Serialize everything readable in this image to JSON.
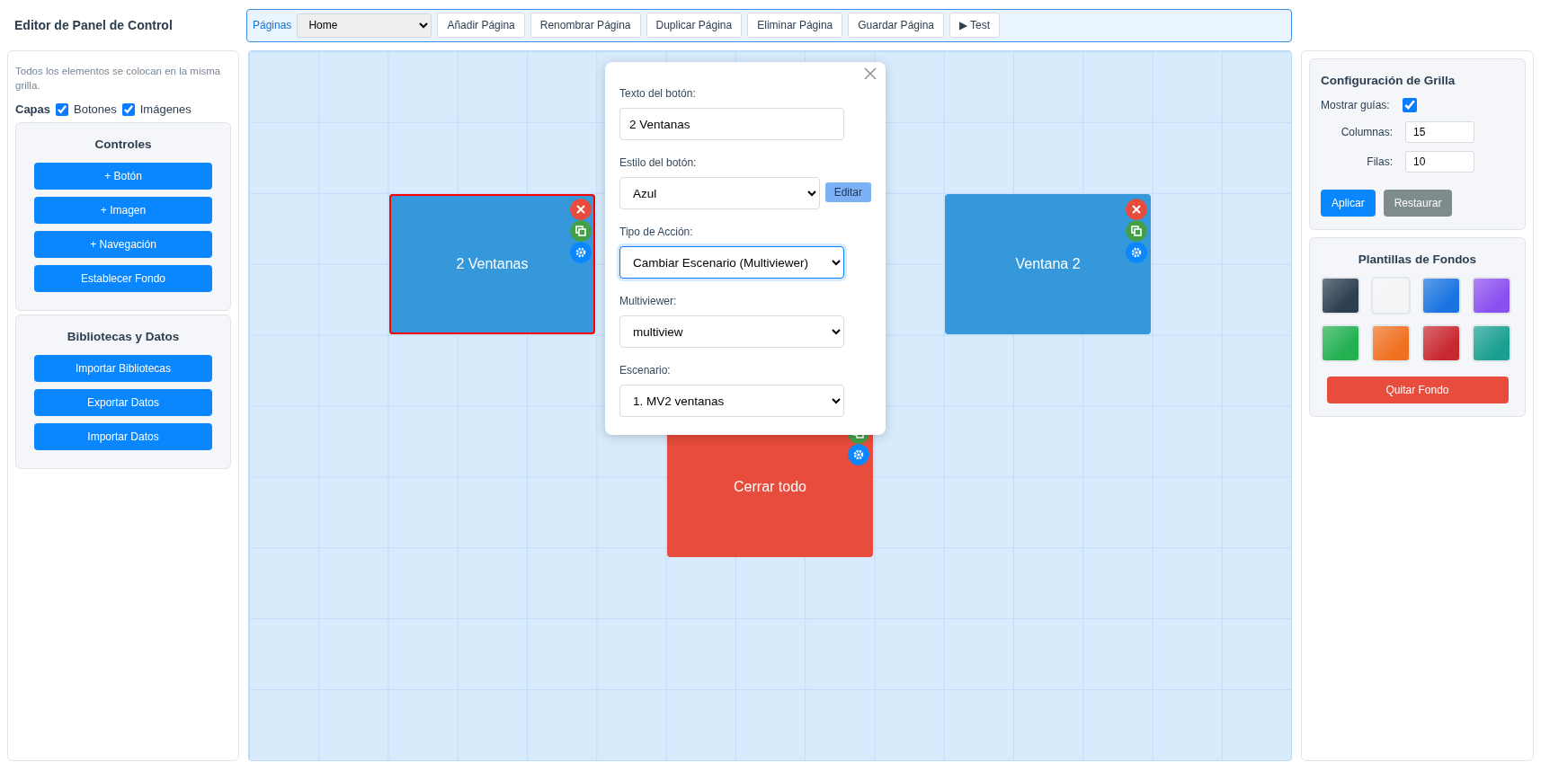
{
  "app_title": "Editor de Panel de Control",
  "toolbar": {
    "label": "Páginas",
    "page_select": "Home",
    "buttons": [
      "Añadir Página",
      "Renombrar Página",
      "Duplicar Página",
      "Eliminar Página",
      "Guardar Página",
      "▶ Test"
    ]
  },
  "left_panel": {
    "hint": "Todos los elementos se colocan en la misma grilla.",
    "layers": {
      "label": "Capas",
      "items": [
        {
          "label": "Botones",
          "checked": true
        },
        {
          "label": "Imágenes",
          "checked": true
        }
      ]
    },
    "sections": [
      {
        "title": "Controles",
        "buttons": [
          "+ Botón",
          "+ Imagen",
          "+ Navegación",
          "Establecer Fondo"
        ]
      },
      {
        "title": "Bibliotecas y Datos",
        "buttons": [
          "Importar Bibliotecas",
          "Exportar Datos",
          "Importar Datos"
        ]
      }
    ]
  },
  "canvas": {
    "buttons": [
      {
        "label": "2 Ventanas",
        "color": "#3498db",
        "selected": true,
        "actions": [
          {
            "kind": "delete"
          },
          {
            "kind": "duplicate"
          },
          {
            "kind": "settings"
          }
        ]
      },
      {
        "label": "Ventana 2",
        "color": "#3498db",
        "selected": false,
        "actions": [
          {
            "kind": "delete"
          },
          {
            "kind": "duplicate"
          },
          {
            "kind": "settings"
          }
        ]
      },
      {
        "label": "Cerrar todo",
        "color": "#e74c3c",
        "selected": false,
        "actions": [
          {
            "kind": "duplicate"
          },
          {
            "kind": "settings"
          }
        ]
      }
    ]
  },
  "editor_dialog": {
    "fields": [
      {
        "kind": "input",
        "label": "Texto del botón:",
        "value": "2 Ventanas",
        "focused": false
      },
      {
        "kind": "select",
        "label": "Estilo del botón:",
        "value": "Azul",
        "button": "Editar",
        "focused": false
      },
      {
        "kind": "select",
        "label": "Tipo de Acción:",
        "value": "Cambiar Escenario (Multiviewer)",
        "focused": true
      },
      {
        "kind": "select",
        "label": "Multiviewer:",
        "value": "multiview",
        "focused": false
      },
      {
        "kind": "select",
        "label": "Escenario:",
        "value": "1. MV2 ventanas",
        "focused": false
      }
    ]
  },
  "grid_settings": {
    "title": "Configuración de Grilla",
    "show_guides": {
      "label": "Mostrar guías:",
      "checked": true
    },
    "fields": [
      {
        "label": "Columnas:",
        "value": "15"
      },
      {
        "label": "Filas:",
        "value": "10"
      }
    ],
    "apply": "Aplicar",
    "reset": "Restaurar"
  },
  "backgrounds": {
    "title": "Plantillas de Fondos",
    "templates": [
      {
        "color": "#2c3e50"
      },
      {
        "color": "#f3f4f6"
      },
      {
        "color": "#1a73e0"
      },
      {
        "color": "#8b50f0"
      },
      {
        "color": "#22b050"
      },
      {
        "color": "#f07020"
      },
      {
        "color": "#c8282f"
      },
      {
        "color": "#1aa090"
      }
    ],
    "remove": "Quitar Fondo"
  }
}
